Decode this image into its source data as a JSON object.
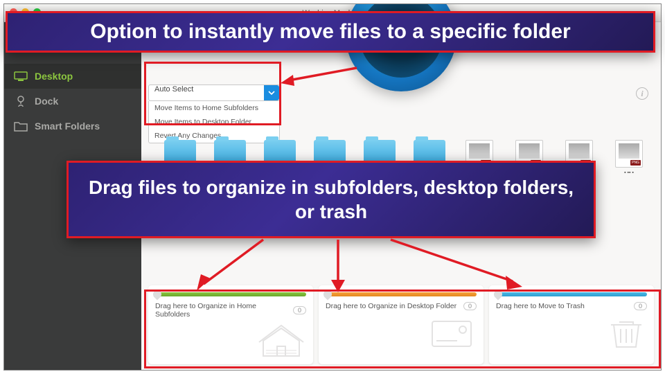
{
  "window": {
    "title": "Washing Machine"
  },
  "sidebar": {
    "items": [
      {
        "label": "Desktop"
      },
      {
        "label": "Dock"
      },
      {
        "label": "Smart Folders"
      }
    ]
  },
  "dropdown": {
    "selected": "Auto Select",
    "options": [
      "Move Items to Home Subfolders",
      "Move Items to Desktop Folder",
      "Revert Any Changes"
    ]
  },
  "zones": [
    {
      "label": "Drag here to Organize in Home Subfolders",
      "count": "0"
    },
    {
      "label": "Drag here to Organize in Desktop Folder",
      "count": "0"
    },
    {
      "label": "Drag here to Move to Trash",
      "count": "0"
    }
  ],
  "annotations": {
    "top": "Option to instantly move files to a specific folder",
    "mid": "Drag files to organize in subfolders, desktop folders, or trash"
  }
}
